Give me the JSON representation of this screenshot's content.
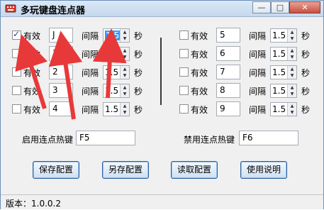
{
  "title": "多玩键盘连点器",
  "window_buttons": {
    "minimize": "—",
    "maximize": "□",
    "close": "✕"
  },
  "left_rows": [
    {
      "checked": true,
      "check_label": "有效",
      "key": "J",
      "interval_label": "间隔",
      "interval": "1.5",
      "unit": "秒"
    },
    {
      "checked": false,
      "check_label": "有效",
      "key": "1",
      "interval_label": "间隔",
      "interval": "1.5",
      "unit": "秒"
    },
    {
      "checked": false,
      "check_label": "有效",
      "key": "2",
      "interval_label": "间隔",
      "interval": "1.5",
      "unit": "秒"
    },
    {
      "checked": false,
      "check_label": "有效",
      "key": "3",
      "interval_label": "间隔",
      "interval": "1.5",
      "unit": "秒"
    },
    {
      "checked": false,
      "check_label": "有效",
      "key": "4",
      "interval_label": "间隔",
      "interval": "1.5",
      "unit": "秒"
    }
  ],
  "right_rows": [
    {
      "checked": false,
      "check_label": "有效",
      "key": "5",
      "interval_label": "间隔",
      "interval": "1.5",
      "unit": "秒"
    },
    {
      "checked": false,
      "check_label": "有效",
      "key": "6",
      "interval_label": "间隔",
      "interval": "1.5",
      "unit": "秒"
    },
    {
      "checked": false,
      "check_label": "有效",
      "key": "7",
      "interval_label": "间隔",
      "interval": "1.5",
      "unit": "秒"
    },
    {
      "checked": false,
      "check_label": "有效",
      "key": "8",
      "interval_label": "间隔",
      "interval": "1.5",
      "unit": "秒"
    },
    {
      "checked": false,
      "check_label": "有效",
      "key": "9",
      "interval_label": "间隔",
      "interval": "1.5",
      "unit": "秒"
    }
  ],
  "hotkeys": {
    "enable_label": "启用连点热键",
    "enable_value": "F5",
    "disable_label": "禁用连点热键",
    "disable_value": "F6"
  },
  "buttons": {
    "save": "保存配置",
    "save_as": "另存配置",
    "load": "读取配置",
    "help": "使用说明"
  },
  "status": "版本：1.0.0.2",
  "colors": {
    "arrow": "#e8393a",
    "title_bar": "#c5d8ee",
    "selection": "#3399ff"
  }
}
